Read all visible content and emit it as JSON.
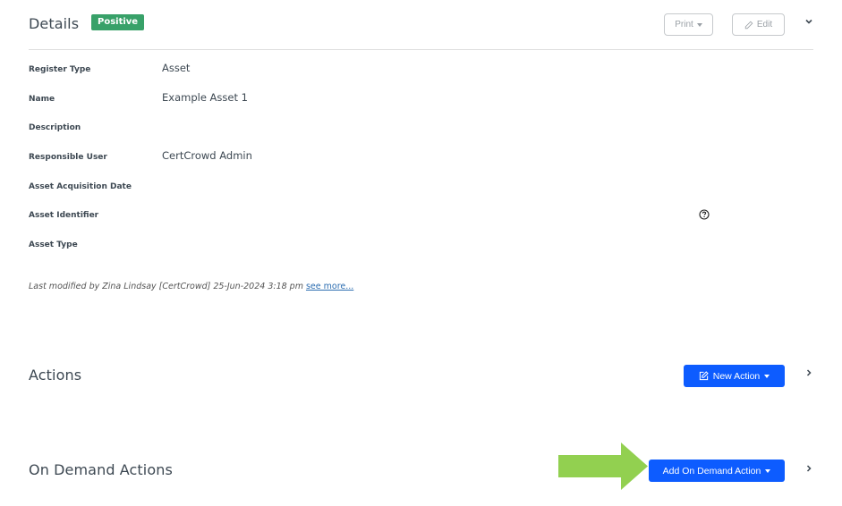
{
  "details": {
    "title": "Details",
    "status_badge": "Positive",
    "print_label": "Print",
    "edit_label": "Edit",
    "fields": [
      {
        "label": "Register Type",
        "value": "Asset"
      },
      {
        "label": "Name",
        "value": "Example Asset 1"
      },
      {
        "label": "Description",
        "value": ""
      },
      {
        "label": "Responsible User",
        "value": "CertCrowd Admin"
      },
      {
        "label": "Asset Acquisition Date",
        "value": ""
      },
      {
        "label": "Asset Identifier",
        "value": ""
      },
      {
        "label": "Asset Type",
        "value": ""
      }
    ],
    "last_modified": "Last modified by Zina Lindsay [CertCrowd] 25-Jun-2024 3:18 pm",
    "see_more": "see more..."
  },
  "actions": {
    "title": "Actions",
    "new_action_label": "New Action"
  },
  "on_demand_actions": {
    "title": "On Demand Actions",
    "add_label": "Add On Demand Action"
  },
  "colors": {
    "primary": "#0d5cff",
    "badge_positive": "#38a169",
    "annotation_arrow": "#92d050"
  }
}
